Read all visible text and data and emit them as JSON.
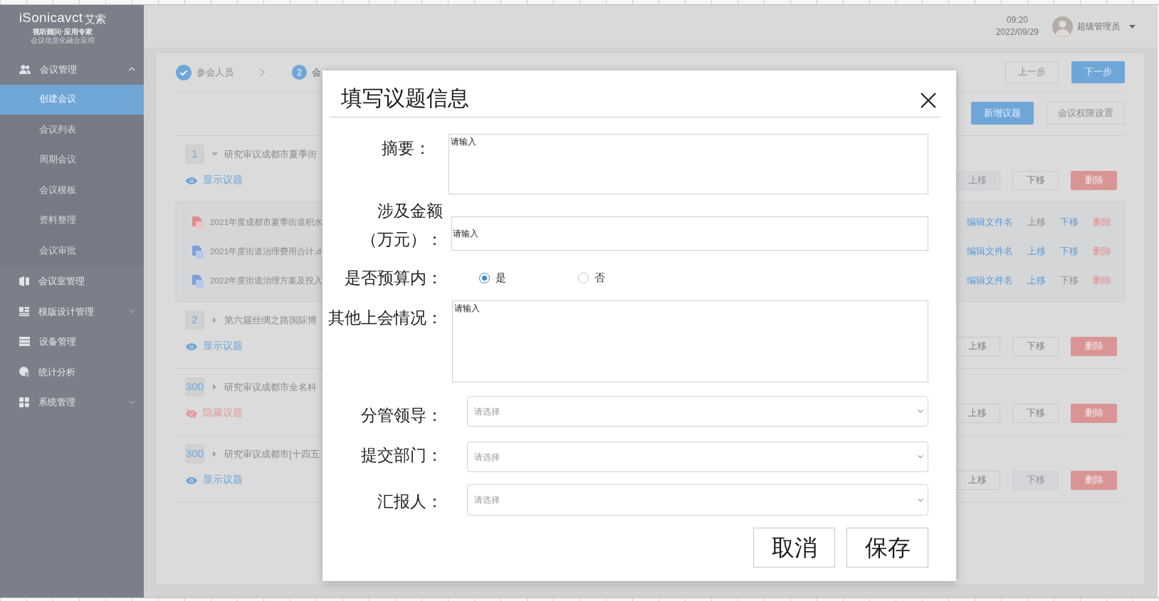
{
  "logo": {
    "wordmark": "iSonicavct",
    "cn_name": "艾索",
    "tagline": "视听顾问·应用专家",
    "subtitle": "会议信息化融合应用"
  },
  "sidebar": {
    "items": [
      {
        "kind": "group",
        "label": "会议管理",
        "selected": false,
        "expanded": true,
        "children": [
          {
            "label": "创建会议",
            "selected": true
          },
          {
            "label": "会议列表",
            "selected": false
          },
          {
            "label": "周期会议",
            "selected": false
          },
          {
            "label": "会议模板",
            "selected": false
          },
          {
            "label": "资料整理",
            "selected": false
          },
          {
            "label": "会议审批",
            "selected": false
          }
        ]
      },
      {
        "kind": "link",
        "label": "会议室管理",
        "selected": false
      },
      {
        "kind": "group",
        "label": "模版设计管理",
        "selected": false,
        "expanded": false
      },
      {
        "kind": "link",
        "label": "设备管理",
        "selected": false
      },
      {
        "kind": "link",
        "label": "统计分析",
        "selected": false
      },
      {
        "kind": "group",
        "label": "系统管理",
        "selected": false,
        "expanded": false
      }
    ]
  },
  "header": {
    "time": "09:20",
    "date": "2022/09/29",
    "user_name": "超级管理员"
  },
  "steps": [
    {
      "label": "参会人员",
      "completed": true
    },
    {
      "number": "2",
      "label": "会",
      "completed": false
    }
  ],
  "nav_buttons": [
    {
      "label": "上一步",
      "kind": "secondary"
    },
    {
      "label": "下一步",
      "kind": "primary"
    }
  ],
  "toolbar_buttons": [
    {
      "label": "新增议题",
      "kind": "primary"
    },
    {
      "label": "会议权限设置",
      "kind": "secondary"
    }
  ],
  "topics": [
    {
      "number": "1",
      "title": "研究审议成都市夏季街",
      "expanded": true,
      "visibility": {
        "label": "显示议题",
        "hidden": false
      },
      "actions": [
        {
          "kind": "up",
          "label": "上移",
          "disabled": true
        },
        {
          "kind": "down",
          "label": "下移",
          "disabled": false
        },
        {
          "kind": "delete",
          "label": "删除",
          "disabled": false
        }
      ],
      "files": [
        {
          "kind": "pdf",
          "name": "2021年度成都市夏季街道积水",
          "actions": [
            {
              "kind": "edit",
              "label": "编辑文件名",
              "disabled": false
            },
            {
              "kind": "up",
              "label": "上移",
              "disabled": true
            },
            {
              "kind": "down",
              "label": "下移",
              "disabled": false
            },
            {
              "kind": "delete",
              "label": "删除",
              "disabled": false
            }
          ]
        },
        {
          "kind": "word",
          "name": "2021年度街道治理费用合计.d",
          "actions": [
            {
              "kind": "edit",
              "label": "编辑文件名",
              "disabled": false
            },
            {
              "kind": "up",
              "label": "上移",
              "disabled": false
            },
            {
              "kind": "down",
              "label": "下移",
              "disabled": false
            },
            {
              "kind": "delete",
              "label": "删除",
              "disabled": false
            }
          ]
        },
        {
          "kind": "word",
          "name": "2022年度街道治理方案及投入",
          "actions": [
            {
              "kind": "edit",
              "label": "编辑文件名",
              "disabled": false
            },
            {
              "kind": "up",
              "label": "上移",
              "disabled": false
            },
            {
              "kind": "down",
              "label": "下移",
              "disabled": true
            },
            {
              "kind": "delete",
              "label": "删除",
              "disabled": false
            }
          ]
        }
      ]
    },
    {
      "number": "2",
      "title": "第六届丝绸之路国际博",
      "expanded": false,
      "visibility": {
        "label": "显示议题",
        "hidden": false
      },
      "actions": [
        {
          "kind": "up",
          "label": "上移",
          "disabled": false
        },
        {
          "kind": "down",
          "label": "下移",
          "disabled": false
        },
        {
          "kind": "delete",
          "label": "删除",
          "disabled": false
        }
      ]
    },
    {
      "number": "300",
      "title": "研究审议成都市全名科",
      "expanded": false,
      "visibility": {
        "label": "隐藏议题",
        "hidden": true
      },
      "actions": [
        {
          "kind": "up",
          "label": "上移",
          "disabled": false
        },
        {
          "kind": "down",
          "label": "下移",
          "disabled": false
        },
        {
          "kind": "delete",
          "label": "删除",
          "disabled": false
        }
      ]
    },
    {
      "number": "300",
      "title": "研究审议成都市[十四五",
      "expanded": false,
      "visibility": {
        "label": "显示议题",
        "hidden": false
      },
      "actions": [
        {
          "kind": "up",
          "label": "上移",
          "disabled": false
        },
        {
          "kind": "down",
          "label": "下移",
          "disabled": true
        },
        {
          "kind": "delete",
          "label": "删除",
          "disabled": false
        }
      ]
    }
  ],
  "dialog": {
    "title": "填写议题信息",
    "fields": [
      {
        "kind": "textarea",
        "label": "摘要：",
        "placeholder": "请输入"
      },
      {
        "kind": "input",
        "label": "涉及金额（万元）：",
        "placeholder": "请输入"
      },
      {
        "kind": "radio",
        "label": "是否预算内：",
        "options": [
          {
            "label": "是",
            "selected": true
          },
          {
            "label": "否",
            "selected": false
          }
        ]
      },
      {
        "kind": "textarea",
        "label": "其他上会情况：",
        "placeholder": "请输入"
      },
      {
        "kind": "select",
        "label": "分管领导：",
        "placeholder": "请选择"
      },
      {
        "kind": "select",
        "label": "提交部门：",
        "placeholder": "请选择"
      },
      {
        "kind": "select",
        "label": "汇报人：",
        "placeholder": "请选择"
      }
    ],
    "buttons": [
      {
        "label": "取消"
      },
      {
        "label": "保存"
      }
    ]
  }
}
